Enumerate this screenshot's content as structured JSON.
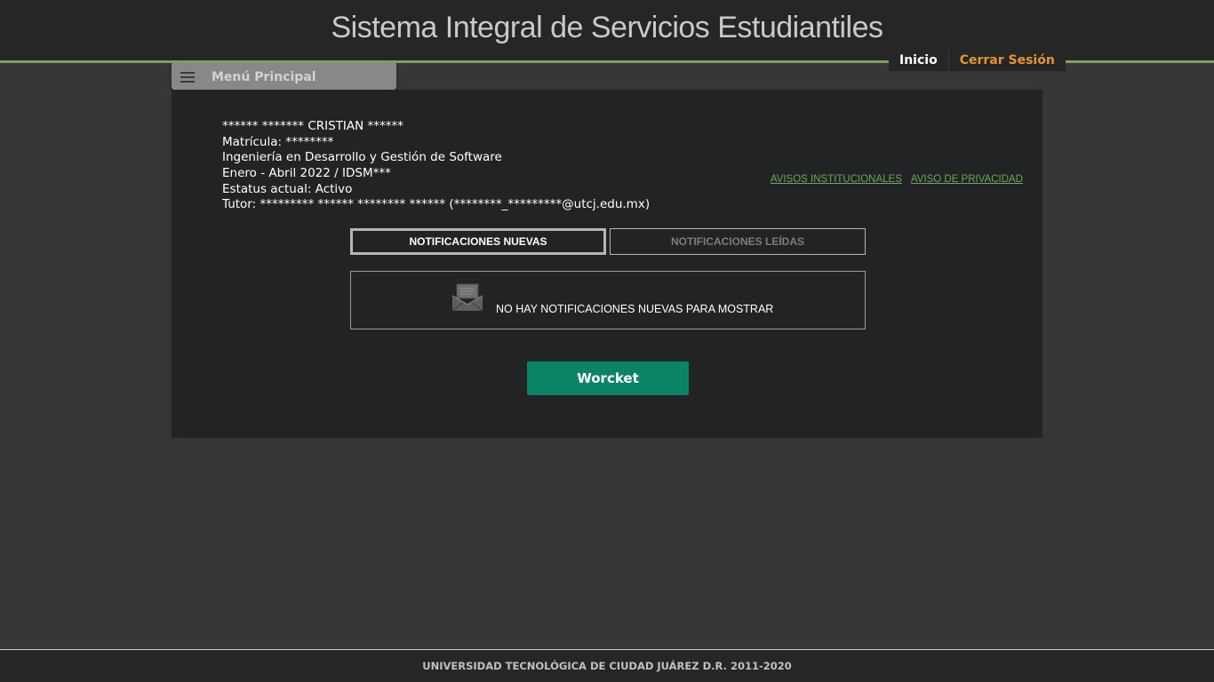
{
  "header": {
    "title": "Sistema Integral de Servicios Estudiantiles",
    "nav": {
      "inicio": "Inicio",
      "cerrar_sesion": "Cerrar Sesión"
    }
  },
  "menu": {
    "label": "Menú Principal",
    "icon": "hamburger-menu-icon"
  },
  "student": {
    "name_line": "****** ******* CRISTIAN ******",
    "matricula_line": "Matrícula: ********",
    "career_line": "Ingeniería en Desarrollo y Gestión de Software",
    "period_line": "Enero - Abril 2022 / IDSM***",
    "status_line": "Estatus actual: Activo",
    "tutor_line": "Tutor: ********* ****** ******** ****** (********_*********@utcj.edu.mx)"
  },
  "links": {
    "avisos_institucionales": "AVISOS INSTITUCIONALES",
    "aviso_privacidad": "AVISO DE PRIVACIDAD"
  },
  "tabs": [
    {
      "label": "NOTIFICACIONES NUEVAS",
      "active": true
    },
    {
      "label": "NOTIFICACIONES LEÍDAS",
      "active": false
    }
  ],
  "notifications": {
    "empty_message": "NO HAY NOTIFICACIONES NUEVAS PARA MOSTRAR",
    "icon": "envelope-icon"
  },
  "actions": {
    "worcket_label": "Worcket"
  },
  "footer": {
    "text": "UNIVERSIDAD TECNOLÓGICA DE CIUDAD JUÁREZ D.R. 2011-2020"
  },
  "colors": {
    "accent_green": "#7ca35c",
    "button_green": "#0a8464",
    "logout_orange": "#e8942c",
    "link_green": "#6aa85b"
  }
}
